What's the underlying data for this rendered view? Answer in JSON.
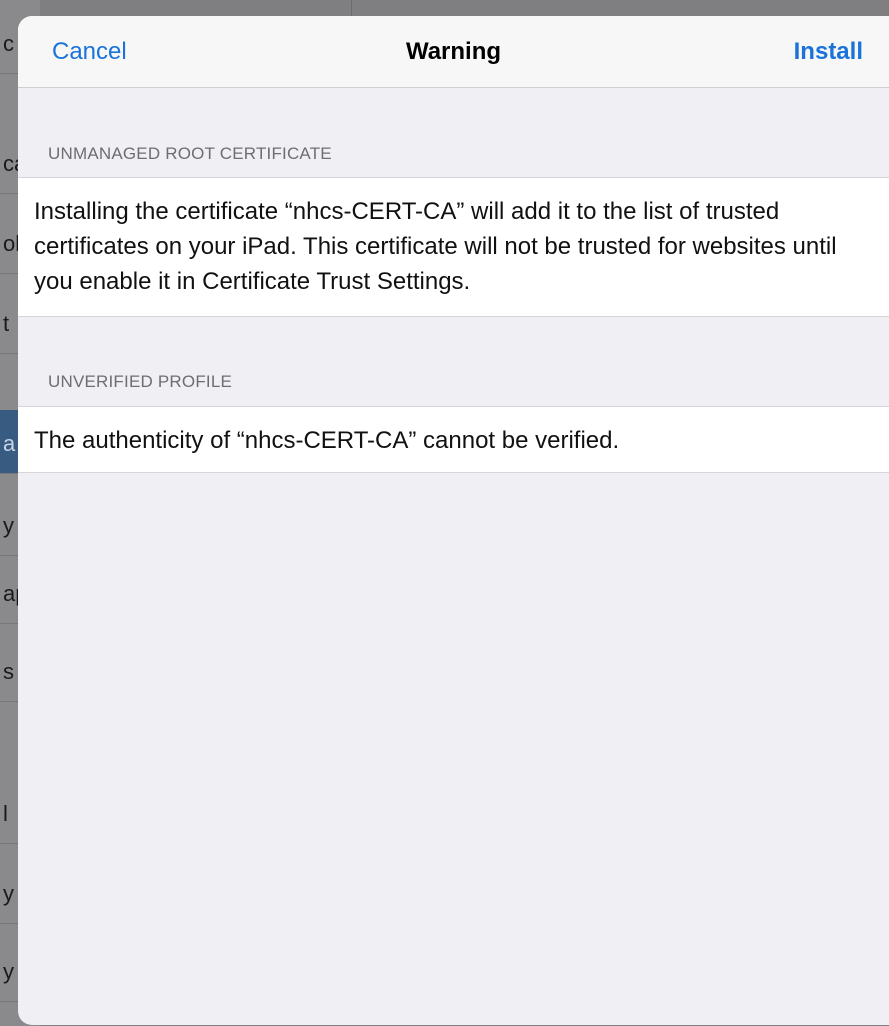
{
  "navbar": {
    "cancel_label": "Cancel",
    "title": "Warning",
    "install_label": "Install"
  },
  "sections": [
    {
      "header": "UNMANAGED ROOT CERTIFICATE",
      "body": "Installing the certificate “nhcs-CERT-CA” will add it to the list of trusted certificates on your iPad. This certificate will not be trusted for websites until you enable it in Certificate Trust Settings."
    },
    {
      "header": "UNVERIFIED PROFILE",
      "body": "The authenticity of “nhcs-CERT-CA” cannot be verified."
    }
  ],
  "background_fragments": [
    "c",
    "ca",
    "ol",
    "t",
    "a",
    "y",
    "ap",
    "s",
    "l",
    "y",
    "y"
  ],
  "colors": {
    "accent": "#1a73d9",
    "sheet_background": "#efeff4",
    "cell_background": "#ffffff",
    "section_header": "#6d6d72"
  }
}
